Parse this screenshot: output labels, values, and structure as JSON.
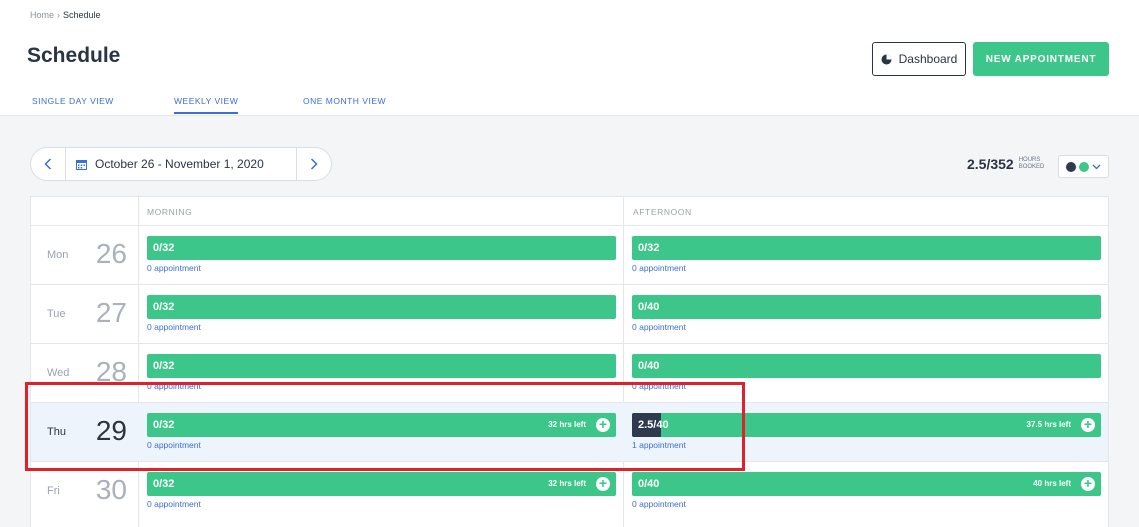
{
  "breadcrumb": {
    "home": "Home",
    "sep": "›",
    "current": "Schedule"
  },
  "page_title": "Schedule",
  "buttons": {
    "dashboard": "Dashboard",
    "new_appointment": "NEW APPOINTMENT"
  },
  "tabs": [
    {
      "label": "SINGLE DAY VIEW"
    },
    {
      "label": "WEEKLY VIEW",
      "active": true
    },
    {
      "label": "ONE MONTH VIEW"
    }
  ],
  "date_range": "October 26 - November 1, 2020",
  "hours": {
    "value": "2.5/352",
    "label_1": "HOURS",
    "label_2": "BOOKED"
  },
  "colors": {
    "accent": "#3cc68a",
    "dark": "#2e3a4e",
    "link": "#3b6fd6",
    "highlight_box": "#e0202a"
  },
  "columns": {
    "morning": "MORNING",
    "afternoon": "AFTERNOON"
  },
  "days": [
    {
      "name": "Mon",
      "num": "26",
      "morning": {
        "ratio": "0/32",
        "appt": "0 appointment",
        "fill": 0
      },
      "afternoon": {
        "ratio": "0/32",
        "appt": "0 appointment",
        "fill": 0
      }
    },
    {
      "name": "Tue",
      "num": "27",
      "morning": {
        "ratio": "0/32",
        "appt": "0 appointment",
        "fill": 0
      },
      "afternoon": {
        "ratio": "0/40",
        "appt": "0 appointment",
        "fill": 0
      }
    },
    {
      "name": "Wed",
      "num": "28",
      "morning": {
        "ratio": "0/32",
        "appt": "0 appointment",
        "fill": 0
      },
      "afternoon": {
        "ratio": "0/40",
        "appt": "0 appointment",
        "fill": 0
      }
    },
    {
      "name": "Thu",
      "num": "29",
      "morning": {
        "ratio": "0/32",
        "appt": "0 appointment",
        "left": "32 hrs left",
        "fill": 0
      },
      "afternoon": {
        "ratio": "2.5/40",
        "appt": "1 appointment",
        "left": "37.5 hrs left",
        "fill": 0.0625
      }
    },
    {
      "name": "Fri",
      "num": "30",
      "morning": {
        "ratio": "0/32",
        "appt": "0 appointment",
        "left": "32 hrs left",
        "fill": 0
      },
      "afternoon": {
        "ratio": "0/40",
        "appt": "0 appointment",
        "left": "40 hrs left",
        "fill": 0
      }
    }
  ]
}
